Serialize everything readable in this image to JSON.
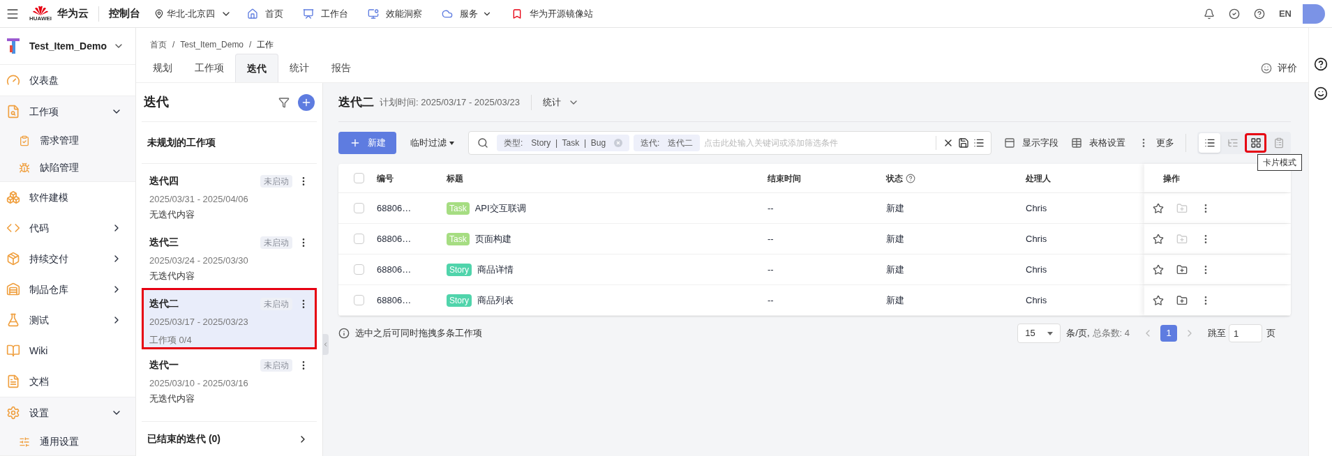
{
  "topbar": {
    "logo_caption": "HUAWEI",
    "brand": "华为云",
    "console": "控制台",
    "region": "华北-北京四",
    "nav": [
      {
        "label": "首页",
        "dropdown": false
      },
      {
        "label": "工作台",
        "dropdown": false
      },
      {
        "label": "效能洞察",
        "dropdown": false
      },
      {
        "label": "服务",
        "dropdown": true
      },
      {
        "label": "华为开源镜像站",
        "dropdown": false
      }
    ],
    "language": "EN"
  },
  "project": {
    "name": "Test_Item_Demo"
  },
  "sidebar": {
    "items": [
      {
        "label": "仪表盘"
      },
      {
        "label": "工作项",
        "expanded": true,
        "children": [
          {
            "label": "需求管理"
          },
          {
            "label": "缺陷管理"
          }
        ]
      },
      {
        "label": "软件建模"
      },
      {
        "label": "代码",
        "expanded": false
      },
      {
        "label": "持续交付",
        "expanded": false
      },
      {
        "label": "制品仓库",
        "expanded": false
      },
      {
        "label": "测试",
        "expanded": false
      },
      {
        "label": "Wiki"
      },
      {
        "label": "文档"
      },
      {
        "label": "设置",
        "expanded": true,
        "children": [
          {
            "label": "通用设置"
          }
        ]
      }
    ]
  },
  "breadcrumb": {
    "separator": "/",
    "items": [
      "首页",
      "Test_Item_Demo",
      "工作"
    ]
  },
  "tabs": [
    {
      "label": "规划",
      "selected": false
    },
    {
      "label": "工作项",
      "selected": false
    },
    {
      "label": "迭代",
      "selected": true
    },
    {
      "label": "统计",
      "selected": false
    },
    {
      "label": "报告",
      "selected": false
    }
  ],
  "feedback": "评价",
  "iteration_panel": {
    "title": "迭代",
    "unplanned": "未规划的工作项",
    "iterations": [
      {
        "name": "迭代四",
        "dates": "2025/03/31 - 2025/04/06",
        "status": "未启动",
        "content": "无迭代内容",
        "selected": false,
        "highlighted": false
      },
      {
        "name": "迭代三",
        "dates": "2025/03/24 - 2025/03/30",
        "status": "未启动",
        "content": "无迭代内容",
        "selected": false,
        "highlighted": false
      },
      {
        "name": "迭代二",
        "dates": "2025/03/17 - 2025/03/23",
        "status": "未启动",
        "content": "工作项 0/4",
        "selected": true,
        "highlighted": true
      },
      {
        "name": "迭代一",
        "dates": "2025/03/10 - 2025/03/16",
        "status": "未启动",
        "content": "无迭代内容",
        "selected": false,
        "highlighted": false
      }
    ],
    "closed": "已结束的迭代 (0)"
  },
  "main": {
    "title": "迭代二",
    "plan_time": "计划时间: 2025/03/17 - 2025/03/23",
    "stats": "统计",
    "new_button": "新建",
    "quick_filter": "临时过滤",
    "filters": [
      {
        "label": "类型:",
        "value": "Story  |  Task  |  Bug",
        "clearable": true
      },
      {
        "label": "迭代:",
        "value": "迭代二",
        "clearable": false
      }
    ],
    "search_placeholder": "点击此处输入关键词或添加筛选条件",
    "actions": [
      "显示字段",
      "表格设置",
      "更多"
    ],
    "views": [
      {
        "selected": true,
        "highlighted": false
      },
      {
        "selected": false,
        "highlighted": false
      },
      {
        "selected": false,
        "highlighted": true,
        "tooltip": "卡片模式"
      },
      {
        "selected": false,
        "highlighted": false
      }
    ],
    "table": {
      "select_all_checked": false,
      "columns": [
        "编号",
        "标题",
        "结束时间",
        "状态",
        "处理人",
        "操作"
      ],
      "rows": [
        {
          "checked": false,
          "id": "68806…",
          "type": "Task",
          "color": "#a6dd82",
          "title": "API交互联调",
          "end": "--",
          "status": "新建",
          "assignee": "Chris",
          "add_disabled": true
        },
        {
          "checked": false,
          "id": "68806…",
          "type": "Task",
          "color": "#a6dd82",
          "title": "页面构建",
          "end": "--",
          "status": "新建",
          "assignee": "Chris",
          "add_disabled": true
        },
        {
          "checked": false,
          "id": "68806…",
          "type": "Story",
          "color": "#50d4ab",
          "title": "商品详情",
          "end": "--",
          "status": "新建",
          "assignee": "Chris",
          "add_disabled": false
        },
        {
          "checked": false,
          "id": "68806…",
          "type": "Story",
          "color": "#50d4ab",
          "title": "商品列表",
          "end": "--",
          "status": "新建",
          "assignee": "Chris",
          "add_disabled": false
        }
      ]
    },
    "hint": "选中之后可同时拖拽多条工作项",
    "pagination": {
      "page_size": "15",
      "per_page": "条/页,",
      "total": "总条数: 4",
      "pages": [
        {
          "label": "1",
          "selected": true
        }
      ],
      "jump": "跳至",
      "jump_value": "1",
      "page_unit": "页"
    }
  }
}
